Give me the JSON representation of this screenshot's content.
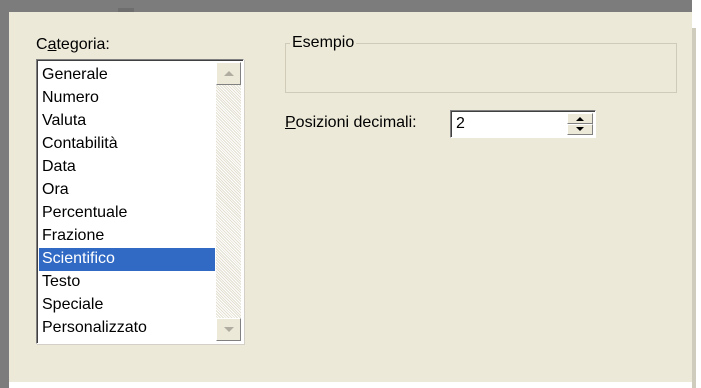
{
  "category": {
    "label_access_key": "a",
    "label_before": "C",
    "label_after": "tegoria:",
    "items": [
      "Generale",
      "Numero",
      "Valuta",
      "Contabilità",
      "Data",
      "Ora",
      "Percentuale",
      "Frazione",
      "Scientifico",
      "Testo",
      "Speciale",
      "Personalizzato"
    ],
    "selected": "Scientifico"
  },
  "example": {
    "legend": "Esempio",
    "content": ""
  },
  "decimal_places": {
    "label_access_key": "P",
    "label_rest": "osizioni decimali:",
    "value": "2"
  },
  "colors": {
    "dialog_background": "#ece9d8",
    "selection_background": "#316ac5",
    "frame_gray": "#7c7c7c"
  },
  "icons": {
    "scroll_up": "triangle-up-icon",
    "scroll_down": "triangle-down-icon",
    "spin_up": "triangle-up-icon",
    "spin_down": "triangle-down-icon"
  }
}
